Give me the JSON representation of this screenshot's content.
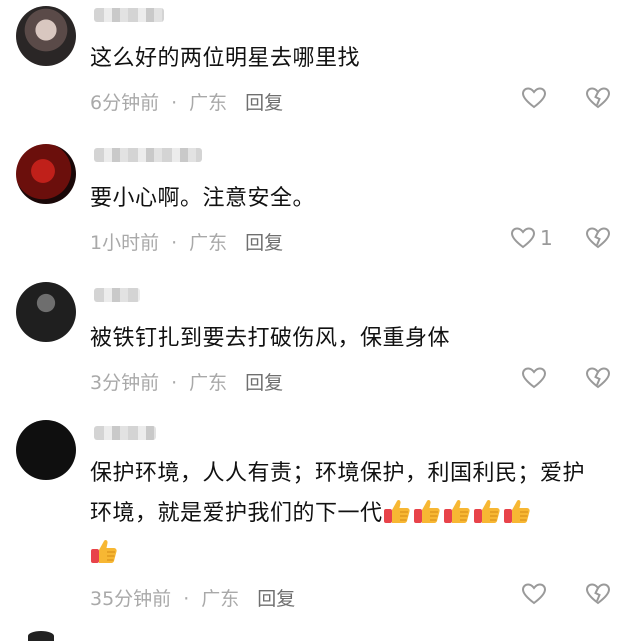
{
  "comments": [
    {
      "text": "这么好的两位明星去哪里找",
      "time": "6分钟前",
      "location": "广东",
      "reply_label": "回复",
      "like_count": ""
    },
    {
      "text": "要小心啊。注意安全。",
      "time": "1小时前",
      "location": "广东",
      "reply_label": "回复",
      "like_count": "1"
    },
    {
      "text": "被铁钉扎到要去打破伤风，保重身体",
      "time": "3分钟前",
      "location": "广东",
      "reply_label": "回复",
      "like_count": ""
    },
    {
      "text_line1": "保护环境，人人有责；环境保护，利国利民；爱护",
      "text_line2": "环境，就是爱护我们的下一代",
      "emoji_count": 6,
      "emoji_name": "thumbs-up-emoji",
      "time": "35分钟前",
      "location": "广东",
      "reply_label": "回复",
      "like_count": ""
    }
  ],
  "separator": "·",
  "icons": {
    "like": "heart-outline-icon",
    "dislike": "broken-heart-icon"
  },
  "colors": {
    "meta_text": "#a9a9a9",
    "reply_text": "#6f6f6f",
    "icon_gray": "#9a9a9a",
    "thumb_yellow": "#f7b733",
    "thumb_red": "#e8434a"
  }
}
